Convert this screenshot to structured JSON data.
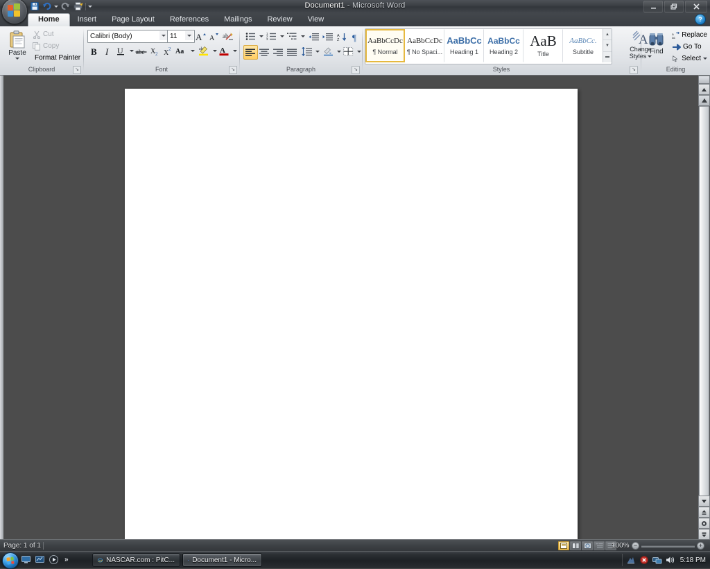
{
  "window": {
    "document_name": "Document1",
    "separator": " - ",
    "app_name": "Microsoft Word",
    "minimize_label": "–",
    "restore_label": "❐",
    "close_label": "✕",
    "help_label": "?"
  },
  "office_button": {
    "name": "office-button"
  },
  "qat": {
    "items": [
      {
        "name": "save-icon",
        "label": "Save"
      },
      {
        "name": "undo-icon",
        "label": "Undo"
      },
      {
        "name": "redo-icon",
        "label": "Redo"
      },
      {
        "name": "quick-print-icon",
        "label": "Quick Print"
      },
      {
        "name": "customize-qat-icon",
        "label": "Customize Quick Access Toolbar"
      }
    ]
  },
  "tabs": [
    {
      "label": "Home",
      "active": true
    },
    {
      "label": "Insert",
      "active": false
    },
    {
      "label": "Page Layout",
      "active": false
    },
    {
      "label": "References",
      "active": false
    },
    {
      "label": "Mailings",
      "active": false
    },
    {
      "label": "Review",
      "active": false
    },
    {
      "label": "View",
      "active": false
    }
  ],
  "ribbon": {
    "clipboard": {
      "group_label": "Clipboard",
      "paste_label": "Paste",
      "cut_label": "Cut",
      "copy_label": "Copy",
      "format_painter_label": "Format Painter",
      "cut_disabled": true,
      "copy_disabled": true
    },
    "font": {
      "group_label": "Font",
      "font_name_value": "Calibri (Body)",
      "font_size_value": "11",
      "buttons": [
        {
          "name": "grow-font-icon",
          "label": "A"
        },
        {
          "name": "shrink-font-icon",
          "label": "A"
        },
        {
          "name": "clear-formatting-icon",
          "label": "Clear Formatting"
        },
        {
          "name": "bold-icon",
          "label": "B"
        },
        {
          "name": "italic-icon",
          "label": "I"
        },
        {
          "name": "underline-icon",
          "label": "U"
        },
        {
          "name": "strikethrough-icon",
          "label": "abc"
        },
        {
          "name": "subscript-icon",
          "label": "X₂"
        },
        {
          "name": "superscript-icon",
          "label": "X²"
        },
        {
          "name": "change-case-icon",
          "label": "Aa"
        },
        {
          "name": "text-highlight-icon",
          "label": "Text Highlight Color"
        },
        {
          "name": "font-color-icon",
          "label": "A"
        }
      ],
      "highlight_color": "#ffe400",
      "font_color": "#c00000"
    },
    "paragraph": {
      "group_label": "Paragraph",
      "buttons": [
        {
          "name": "bullets-icon",
          "label": "Bullets"
        },
        {
          "name": "numbering-icon",
          "label": "Numbering"
        },
        {
          "name": "multilevel-list-icon",
          "label": "Multilevel List"
        },
        {
          "name": "decrease-indent-icon",
          "label": "Decrease Indent"
        },
        {
          "name": "increase-indent-icon",
          "label": "Increase Indent"
        },
        {
          "name": "sort-icon",
          "label": "Sort"
        },
        {
          "name": "show-hide-marks-icon",
          "label": "¶"
        },
        {
          "name": "align-left-icon",
          "label": "Align Text Left"
        },
        {
          "name": "align-center-icon",
          "label": "Center"
        },
        {
          "name": "align-right-icon",
          "label": "Align Text Right"
        },
        {
          "name": "justify-icon",
          "label": "Justify"
        },
        {
          "name": "line-spacing-icon",
          "label": "Line Spacing"
        },
        {
          "name": "shading-icon",
          "label": "Shading"
        },
        {
          "name": "borders-icon",
          "label": "Borders"
        }
      ],
      "active_alignment": "align-left-icon"
    },
    "styles": {
      "group_label": "Styles",
      "items": [
        {
          "preview": "AaBbCcDc",
          "name": "¶ Normal",
          "selected": true,
          "preview_style": "normal"
        },
        {
          "preview": "AaBbCcDc",
          "name": "¶ No Spaci...",
          "selected": false,
          "preview_style": "normal"
        },
        {
          "preview": "AaBbCс",
          "name": "Heading 1",
          "selected": false,
          "preview_style": "heading1"
        },
        {
          "preview": "AaBbCc",
          "name": "Heading 2",
          "selected": false,
          "preview_style": "heading2"
        },
        {
          "preview": "AaB",
          "name": "Title",
          "selected": false,
          "preview_style": "title"
        },
        {
          "preview": "AaBbCc.",
          "name": "Subtitle",
          "selected": false,
          "preview_style": "subtitle"
        }
      ],
      "scroll_up": "▲",
      "scroll_down": "▼",
      "scroll_more": "▬",
      "change_styles_line1": "Change",
      "change_styles_line2": "Styles"
    },
    "editing": {
      "group_label": "Editing",
      "find_label": "Find",
      "replace_label": "Replace",
      "goto_label": "Go To",
      "select_label": "Select"
    },
    "dialog_launcher_glyph": "⤵"
  },
  "scrollbar": {
    "up_arrow": "▲",
    "down_arrow": "▼",
    "previous_page": "▲",
    "next_page": "▼",
    "browse_object": "browse-object"
  },
  "statusbar": {
    "page_text": "Page: 1 of 1",
    "zoom_value": "100%",
    "zoom_out": "−",
    "zoom_in": "+",
    "view_buttons": [
      {
        "name": "print-layout-view",
        "active": true
      },
      {
        "name": "full-screen-reading-view",
        "active": false
      },
      {
        "name": "web-layout-view",
        "active": false
      },
      {
        "name": "outline-view",
        "active": false
      },
      {
        "name": "draft-view",
        "active": false
      }
    ]
  },
  "taskbar": {
    "start_label": "Start",
    "quick_launch": [
      {
        "name": "show-desktop-icon",
        "label": "Show Desktop"
      },
      {
        "name": "switch-windows-icon",
        "label": "Switch between windows"
      },
      {
        "name": "media-player-icon",
        "label": "Windows Media Player"
      }
    ],
    "overflow_label": "»",
    "windows": [
      {
        "name": "taskbar-item-internet-explorer",
        "label": "NASCAR.com : PitC...",
        "icon": "internet-explorer-icon",
        "active": false
      },
      {
        "name": "taskbar-item-word",
        "label": "Document1 - Micro...",
        "icon": "word-icon",
        "active": true
      }
    ],
    "tray": [
      {
        "name": "tray-icon-action-center",
        "label": "Action"
      },
      {
        "name": "tray-icon-security-alert",
        "label": "Security Alert"
      },
      {
        "name": "tray-icon-network",
        "label": "Network"
      },
      {
        "name": "tray-icon-volume",
        "label": "Volume"
      }
    ],
    "clock": "5:18 PM"
  }
}
